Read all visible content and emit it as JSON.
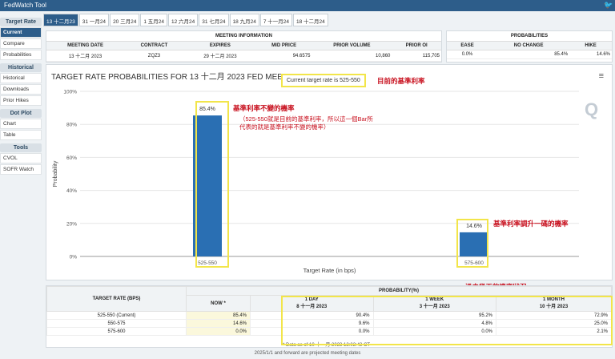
{
  "app_title": "FedWatch Tool",
  "sidebar": {
    "groups": [
      {
        "title": "Target Rate",
        "items": [
          "Current",
          "Compare",
          "Probabilities"
        ]
      },
      {
        "title": "Historical",
        "items": [
          "Historical",
          "Downloads",
          "Prior Hikes"
        ]
      },
      {
        "title": "Dot Plot",
        "items": [
          "Chart",
          "Table"
        ]
      },
      {
        "title": "Tools",
        "items": [
          "CVOL",
          "SOFR Watch"
        ]
      }
    ]
  },
  "tabs": [
    "13 十二月23",
    "31 一月24",
    "20 三月24",
    "1 五月24",
    "12 六月24",
    "31 七月24",
    "18 九月24",
    "7 十一月24",
    "18 十二月24"
  ],
  "meeting_info": {
    "title": "MEETING INFORMATION",
    "headers": [
      "MEETING DATE",
      "CONTRACT",
      "EXPIRES",
      "MID PRICE",
      "PRIOR VOLUME",
      "PRIOR OI"
    ],
    "values": [
      "13 十二月 2023",
      "ZQZ3",
      "29 十二月 2023",
      "94.6575",
      "10,860",
      "115,705"
    ]
  },
  "probabilities": {
    "title": "PROBABILITIES",
    "headers": [
      "EASE",
      "NO CHANGE",
      "HIKE"
    ],
    "values": [
      "0.0%",
      "85.4%",
      "14.6%"
    ]
  },
  "chart": {
    "title": "TARGET RATE PROBABILITIES FOR 13 十二月 2023 FED MEETING",
    "current_rate": "Current target rate is 525-550",
    "xlabel": "Target Rate (in bps)",
    "ylabel": "Probability",
    "watermark": "Q"
  },
  "chart_data": {
    "type": "bar",
    "categories": [
      "525-550",
      "575-600"
    ],
    "values": [
      85.4,
      14.6
    ],
    "value_labels": [
      "85.4%",
      "14.6%"
    ],
    "title": "TARGET RATE PROBABILITIES FOR 13 十二月 2023 FED MEETING",
    "xlabel": "Target Rate (in bps)",
    "ylabel": "Probability",
    "ylim": [
      0,
      100
    ],
    "yticks": [
      "0%",
      "20%",
      "40%",
      "60%",
      "80%",
      "100%"
    ],
    "grid": true,
    "color": "#2a6fb3"
  },
  "annotations": {
    "current_rate_note": "目前的基準利率",
    "unchanged_title": "基準利率不變的機率",
    "unchanged_detail": "（525-550就是目前的基準利率，所以這一個Bar所代表的就是基準利率不變的機率）",
    "hike_note": "基準利率調升一碼的機率",
    "history_note": "過去幾天的機率狀況"
  },
  "prob_table": {
    "rate_header": "TARGET RATE (BPS)",
    "prob_header": "PROBABILITY(%)",
    "now_header": "NOW *",
    "cols": [
      {
        "label": "1 DAY",
        "date": "8 十一月 2023"
      },
      {
        "label": "1 WEEK",
        "date": "3 十一月 2023"
      },
      {
        "label": "1 MONTH",
        "date": "10 十月 2023"
      }
    ],
    "rows": [
      {
        "rate": "525-550 (Current)",
        "now": "85.4%",
        "d1": "90.4%",
        "w1": "95.2%",
        "m1": "72.9%"
      },
      {
        "rate": "550-575",
        "now": "14.6%",
        "d1": "9.6%",
        "w1": "4.8%",
        "m1": "25.0%"
      },
      {
        "rate": "575-600",
        "now": "0.0%",
        "d1": "0.0%",
        "w1": "0.0%",
        "m1": "2.1%"
      }
    ],
    "data_asof": "* Data as of 10 十一月 2023 12:02:42 CT",
    "footer": "2025/1/1 and forward are projected meeting dates"
  },
  "colors": {
    "accent": "#2d5d8a",
    "bar": "#2a6fb3",
    "highlight": "#f2e54a",
    "annotation": "#c8101e"
  }
}
